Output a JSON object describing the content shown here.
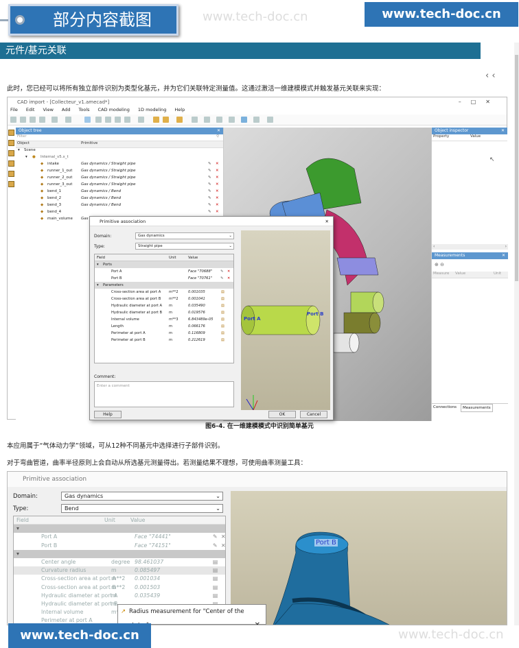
{
  "header": {
    "badge": "部分内容截图",
    "watermark": "www.tech-doc.cn",
    "site": "www.tech-doc.cn"
  },
  "section": {
    "title": "元件/基元关联"
  },
  "nav": {
    "prev": "‹",
    "next": "^",
    "nextdown": "^"
  },
  "intro": "此时，您已经可以将所有独立部件识别为类型化基元，并为它们关联特定测量值。这通过激活一维建模模式并触发基元关联来实现：",
  "app": {
    "title": "CAD import - [Collecteur_v1.amecad*]",
    "menu": [
      "File",
      "Edit",
      "View",
      "Add",
      "Tools",
      "CAD modeling",
      "1D modeling",
      "Help"
    ],
    "object_tree": {
      "title": "Object tree",
      "filter": "Filter",
      "col_object": "Object",
      "col_primitive": "Primitive",
      "scene": "Scene",
      "internal": "Internal_v5.x_t",
      "items": [
        {
          "name": "intake",
          "prim": "Gas dynamics / Straight pipe"
        },
        {
          "name": "runner_1_out",
          "prim": "Gas dynamics / Straight pipe"
        },
        {
          "name": "runner_2_out",
          "prim": "Gas dynamics / Straight pipe"
        },
        {
          "name": "runner_3_out",
          "prim": "Gas dynamics / Straight pipe"
        },
        {
          "name": "bend_1",
          "prim": "Gas dynamics / Bend"
        },
        {
          "name": "bend_2",
          "prim": "Gas dynamics / Bend"
        },
        {
          "name": "bend_3",
          "prim": "Gas dynamics / Bend"
        },
        {
          "name": "bend_4",
          "prim": ""
        },
        {
          "name": "main_volume",
          "prim": "Gas"
        }
      ]
    },
    "inspector": {
      "title": "Object inspector",
      "col_property": "Property",
      "col_value": "Value"
    },
    "measurements": {
      "title": "Measurements",
      "col_measure": "Measure",
      "col_value": "Value",
      "col_unit": "Unit",
      "tab1": "Connections",
      "tab2": "Measurements"
    },
    "dialog": {
      "title": "Primitive association",
      "domain_label": "Domain:",
      "domain": "Gas dynamics",
      "type_label": "Type:",
      "type": "Straight pipe",
      "col_field": "Field",
      "col_unit": "Unit",
      "col_value": "Value",
      "ports": "Ports",
      "parameters": "Parameters",
      "port_rows": [
        {
          "f": "Port A",
          "u": "",
          "v": "Face \"70688\""
        },
        {
          "f": "Port B",
          "u": "",
          "v": "Face \"70761\""
        }
      ],
      "param_rows": [
        {
          "f": "Cross-section area at port A",
          "u": "m**2",
          "v": "0.001035"
        },
        {
          "f": "Cross-section area at port B",
          "u": "m**2",
          "v": "0.001041"
        },
        {
          "f": "Hydraulic diameter at port A",
          "u": "m",
          "v": "0.035490"
        },
        {
          "f": "Hydraulic diameter at port B",
          "u": "m",
          "v": "0.019576"
        },
        {
          "f": "Internal volume",
          "u": "m**3",
          "v": "6.843489e-05"
        },
        {
          "f": "Length",
          "u": "m",
          "v": "0.066176"
        },
        {
          "f": "Perimeter at port A",
          "u": "m",
          "v": "0.116809"
        },
        {
          "f": "Perimeter at port B",
          "u": "m",
          "v": "0.212619"
        }
      ],
      "comment_label": "Comment:",
      "comment_placeholder": "Enter a comment",
      "help": "Help",
      "ok": "OK",
      "cancel": "Cancel",
      "portA": "Port A",
      "portB": "Port B"
    }
  },
  "caption": "图6-4. 在一维建模模式中识别简单基元",
  "para2": "本应用属于“气体动力学”领域，可从12种不同基元中选择进行子部件识别。",
  "para3": "对于弯曲管道，曲率半径原则上会自动从所选基元测量得出。若测量结果不理想，可使用曲率测量工具：",
  "dialog2": {
    "title": "Primitive association",
    "domain_label": "Domain:",
    "domain": "Gas dynamics",
    "type_label": "Type:",
    "type": "Bend",
    "col_field": "Field",
    "col_unit": "Unit",
    "col_value": "Value",
    "rows": [
      {
        "f": "Port A",
        "u": "",
        "v": "Face \"74441\""
      },
      {
        "f": "Port B",
        "u": "",
        "v": "Face \"74151\""
      },
      {
        "f": "Center angle",
        "u": "degree",
        "v": "98.461037"
      },
      {
        "f": "Curvature radius",
        "u": "m",
        "v": "0.085497"
      },
      {
        "f": "Cross-section area at port A",
        "u": "m**2",
        "v": "0.001034"
      },
      {
        "f": "Cross-section area at port B",
        "u": "m**2",
        "v": "0.001503"
      },
      {
        "f": "Hydraulic diameter at port A",
        "u": "m",
        "v": "0.035439"
      },
      {
        "f": "Hydraulic diameter at port B",
        "u": "m",
        "v": ""
      },
      {
        "f": "Internal volume",
        "u": "m**",
        "v": ""
      },
      {
        "f": "Perimeter at port A",
        "u": "",
        "v": ""
      }
    ],
    "portB": "Port B",
    "radius_title": "Radius measurement for \"Center of the stator\""
  }
}
